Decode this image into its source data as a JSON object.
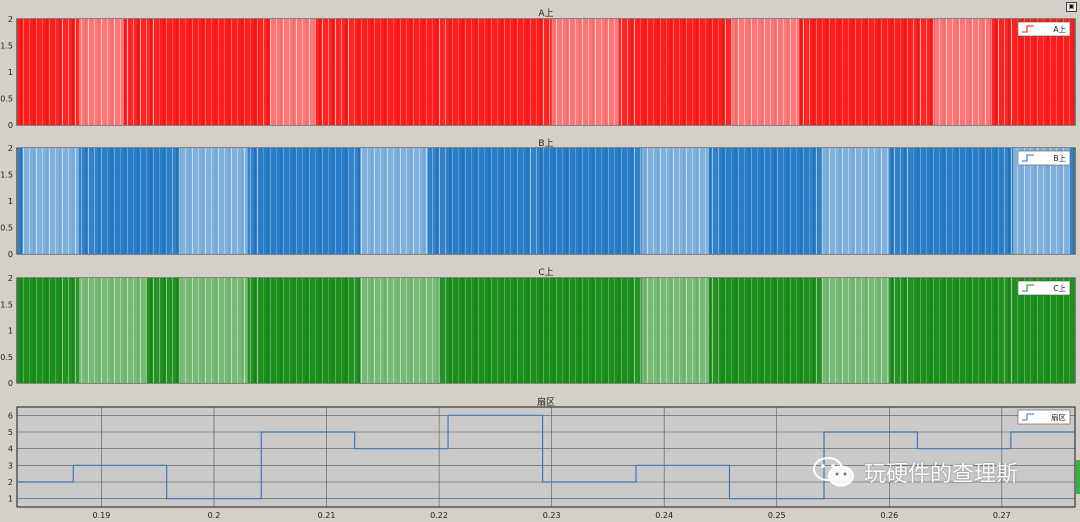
{
  "window": {
    "corner_button": "▣",
    "watermark_text": "玩硬件的查理斯",
    "watermark_icon": "wechat-icon"
  },
  "chart_data": [
    {
      "type": "line",
      "title": "A上",
      "legend": "A上",
      "legend_position": "top-right",
      "color": "#ff1414",
      "signal": "pwm",
      "ylim": [
        0,
        2
      ],
      "yticks": [
        "0",
        "0.5",
        "1",
        "1.5",
        "2"
      ],
      "xlim": [
        0.1825,
        0.2765
      ],
      "xticks": [],
      "grid": true,
      "dense_regions": [
        [
          0.1825,
          0.186
        ],
        [
          0.195,
          0.204
        ],
        [
          0.2125,
          0.22
        ],
        [
          0.221,
          0.229
        ],
        [
          0.2375,
          0.245
        ],
        [
          0.253,
          0.262
        ],
        [
          0.271,
          0.2765
        ]
      ],
      "light_regions": [
        [
          0.188,
          0.192
        ],
        [
          0.205,
          0.209
        ],
        [
          0.23,
          0.236
        ],
        [
          0.246,
          0.252
        ],
        [
          0.264,
          0.269
        ]
      ]
    },
    {
      "type": "line",
      "title": "B上",
      "legend": "B上",
      "legend_position": "top-right",
      "color": "#1f78c8",
      "signal": "pwm",
      "ylim": [
        0,
        2
      ],
      "yticks": [
        "0",
        "0.5",
        "1",
        "1.5",
        "2"
      ],
      "xlim": [
        0.1825,
        0.2765
      ],
      "xticks": [],
      "grid": true,
      "dense_regions": [
        [
          0.19,
          0.196
        ],
        [
          0.204,
          0.212
        ],
        [
          0.221,
          0.228
        ],
        [
          0.229,
          0.237
        ],
        [
          0.245,
          0.253
        ],
        [
          0.262,
          0.27
        ]
      ],
      "light_regions": [
        [
          0.183,
          0.188
        ],
        [
          0.197,
          0.203
        ],
        [
          0.213,
          0.219
        ],
        [
          0.238,
          0.244
        ],
        [
          0.254,
          0.26
        ],
        [
          0.271,
          0.276
        ]
      ]
    },
    {
      "type": "line",
      "title": "C上",
      "legend": "C上",
      "legend_position": "top-right",
      "color": "#148c14",
      "signal": "pwm",
      "ylim": [
        0,
        2
      ],
      "yticks": [
        "0",
        "0.5",
        "1",
        "1.5",
        "2"
      ],
      "xlim": [
        0.1825,
        0.2765
      ],
      "xticks": [],
      "grid": true,
      "dense_regions": [
        [
          0.1825,
          0.1865
        ],
        [
          0.204,
          0.212
        ],
        [
          0.221,
          0.229
        ],
        [
          0.229,
          0.237
        ],
        [
          0.245,
          0.253
        ],
        [
          0.262,
          0.27
        ],
        [
          0.271,
          0.2765
        ]
      ],
      "light_regions": [
        [
          0.188,
          0.194
        ],
        [
          0.197,
          0.203
        ],
        [
          0.213,
          0.22
        ],
        [
          0.238,
          0.244
        ],
        [
          0.254,
          0.26
        ]
      ]
    },
    {
      "type": "line",
      "title": "扇区",
      "legend": "扇区",
      "legend_position": "top-right",
      "color": "#3c78b4",
      "signal": "step",
      "ylim": [
        0.5,
        6.5
      ],
      "yticks": [
        "1",
        "2",
        "3",
        "4",
        "5",
        "6"
      ],
      "xlim": [
        0.1825,
        0.2765
      ],
      "xticks": [
        "0.19",
        "0.2",
        "0.21",
        "0.22",
        "0.23",
        "0.24",
        "0.25",
        "0.26",
        "0.27"
      ],
      "grid": true,
      "steps": {
        "x": [
          0.1825,
          0.1875,
          0.1958,
          0.2042,
          0.2125,
          0.2208,
          0.2292,
          0.2375,
          0.2458,
          0.2542,
          0.2625,
          0.2708,
          0.2765
        ],
        "y": [
          2,
          3,
          1,
          5,
          4,
          6,
          2,
          3,
          1,
          5,
          4,
          5,
          5
        ]
      }
    }
  ]
}
